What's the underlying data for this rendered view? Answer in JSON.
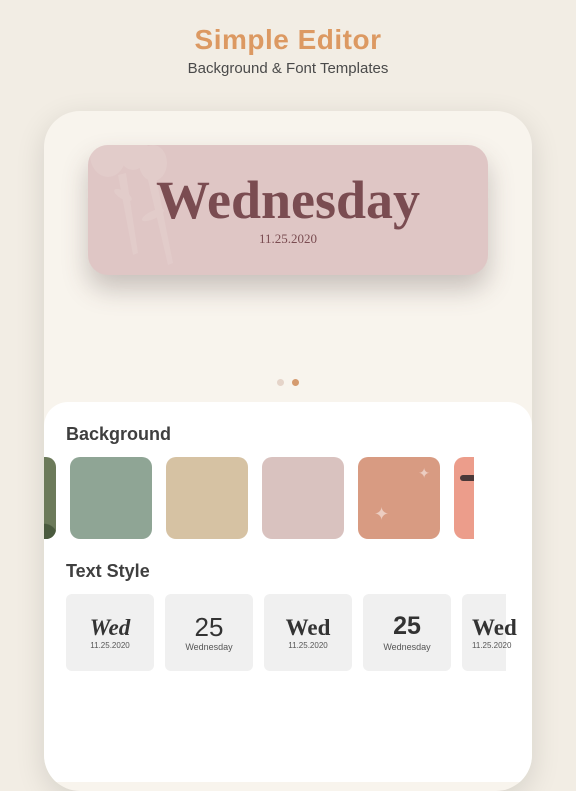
{
  "header": {
    "title": "Simple Editor",
    "subtitle": "Background & Font Templates"
  },
  "preview": {
    "day": "Wednesday",
    "date": "11.25.2020"
  },
  "sections": {
    "background": "Background",
    "textStyle": "Text Style"
  },
  "backgrounds": [
    {
      "id": "bg-0",
      "color": "#6c7a5a"
    },
    {
      "id": "bg-1",
      "color": "#8fa595"
    },
    {
      "id": "bg-2",
      "color": "#d6c2a3"
    },
    {
      "id": "bg-3",
      "color": "#d9c2bf"
    },
    {
      "id": "bg-4",
      "color": "#d89b82",
      "decorated": true
    },
    {
      "id": "bg-5",
      "color": "#ec9d8b"
    }
  ],
  "textStyles": [
    {
      "main": "Wed",
      "sub": "11.25.2020"
    },
    {
      "main": "25",
      "sub": "Wednesday"
    },
    {
      "main": "Wed",
      "sub": "11.25.2020"
    },
    {
      "main": "25",
      "sub": "Wednesday"
    },
    {
      "main": "Wed",
      "sub": "11.25.2020"
    }
  ]
}
